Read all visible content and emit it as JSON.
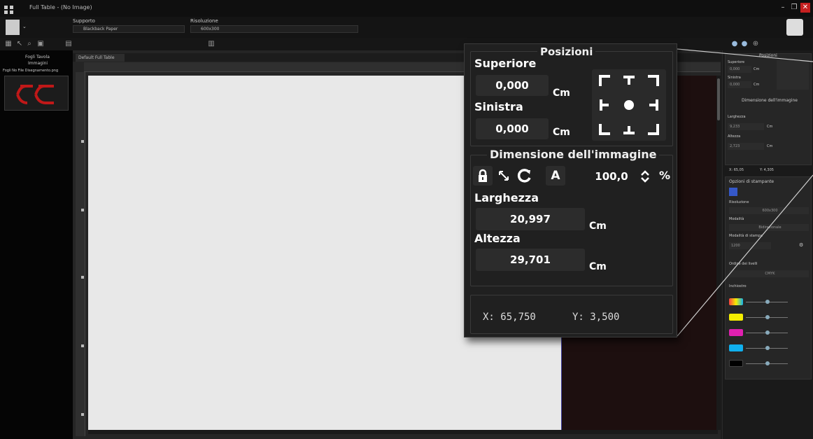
{
  "window": {
    "title": "Full Table - (No Image)"
  },
  "ribbon": {
    "supporto_label": "Supporto",
    "supporto_value": "Blackback Paper",
    "risoluzione_label": "Risoluzione",
    "risoluzione_value": "600x300"
  },
  "tabs": [
    {
      "label": "Default Full Table"
    }
  ],
  "left_panel": {
    "title": "Fogli Tavola",
    "subtitle": "Immagini",
    "item": "Fogli No File Disegnamento.png"
  },
  "right_panel": {
    "posizioni_title": "Posizioni",
    "superiore_label": "Superiore",
    "superiore_value": "0,000",
    "sinistra_label": "Sinistra",
    "sinistra_value": "0,000",
    "dim_title": "Dimensione dell'immagine",
    "larghezza_label": "Larghezza",
    "larghezza_value": "9,233",
    "altezza_label": "Altezza",
    "altezza_value": "2,723",
    "unit": "Cm",
    "coords_x": "X: 65,05",
    "coords_y": "Y: 4,305",
    "opzioni_title": "Opzioni di stampante",
    "risoluzione_label": "Risoluzione",
    "risoluzione_value": "600x300",
    "modalita_label": "Modalità",
    "modalita_value": "Bidirezionale",
    "modalita_stampa_label": "Modalità di stampa",
    "modalita_stampa_value": "1200",
    "ordine_label": "Ordine dei livelli",
    "ordine_value": "CMYK",
    "inchiostro_label": "Inchiostro",
    "ink_colors": [
      "#ff4040",
      "#f4ee00",
      "#e020b0",
      "#10b0ee",
      "#000000"
    ]
  },
  "zoom": {
    "posizioni_title": "Posizioni",
    "superiore_label": "Superiore",
    "superiore_value": "0,000",
    "sinistra_label": "Sinistra",
    "sinistra_value": "0,000",
    "unit": "Cm",
    "dimensione_title": "Dimensione dell'immagine",
    "lock_icon": "lock-icon",
    "scale_value": "100,0",
    "percent": "%",
    "auto_label": "A",
    "larghezza_label": "Larghezza",
    "larghezza_value": "20,997",
    "altezza_label": "Altezza",
    "altezza_value": "29,701",
    "coord_x": "X:  65,750",
    "coord_y": "Y:  3,500"
  }
}
